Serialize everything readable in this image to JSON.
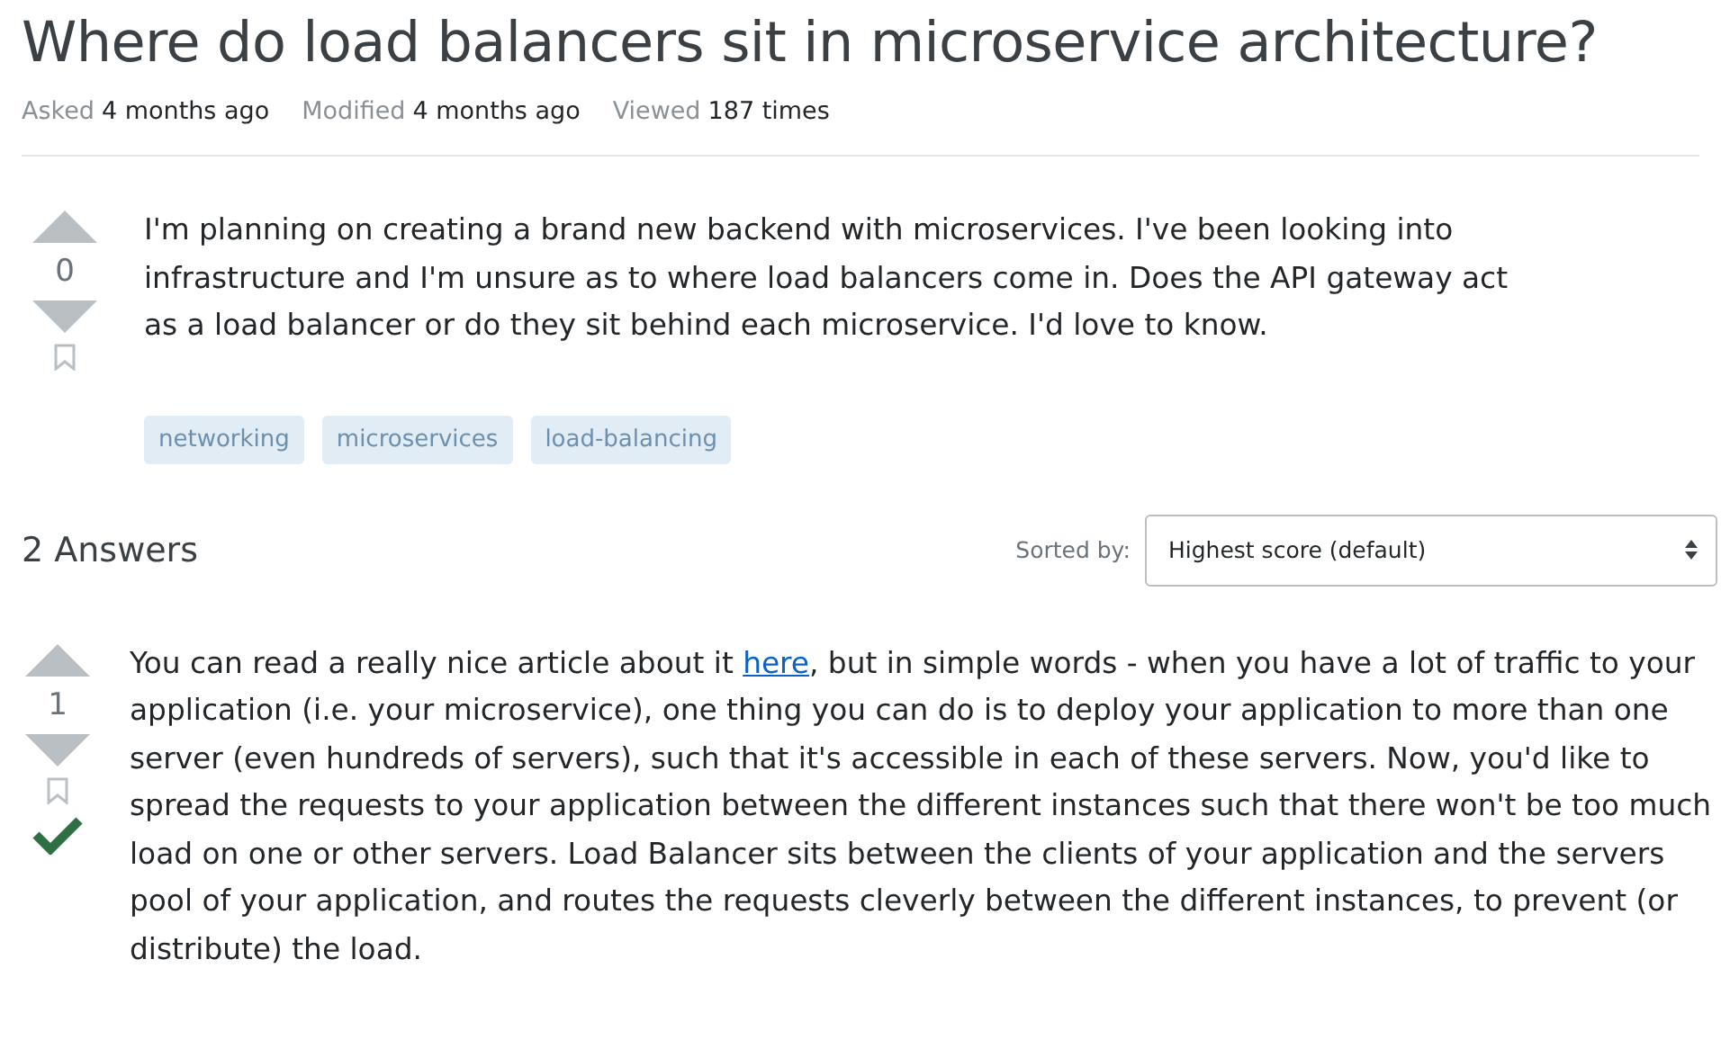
{
  "title": "Where do load balancers sit in microservice architecture?",
  "meta": [
    {
      "label": "Asked",
      "value": "4 months ago"
    },
    {
      "label": "Modified",
      "value": "4 months ago"
    },
    {
      "label": "Viewed",
      "value": "187 times"
    }
  ],
  "question": {
    "score": "0",
    "accepted": false,
    "body": [
      {
        "kind": "text",
        "text": "I'm planning on creating a brand new backend with microservices. I've been looking into infrastructure and I'm unsure as to where load balancers come in. Does the API gateway act as a load balancer or do they sit behind each microservice. I'd love to know."
      }
    ],
    "tags": [
      "networking",
      "microservices",
      "load-balancing"
    ]
  },
  "answers_header": {
    "count": "2 Answers",
    "sort_label": "Sorted by:",
    "sort_value": "Highest score (default)"
  },
  "answers": [
    {
      "score": "1",
      "accepted": true,
      "body": [
        {
          "kind": "text",
          "text": "You can read a really nice article about it "
        },
        {
          "kind": "link",
          "text": "here"
        },
        {
          "kind": "text",
          "text": ", but in simple words - when you have a lot of traffic to your application (i.e. your microservice), one thing you can do is to deploy your application to more than one server (even hundreds of servers), such that it's accessible in each of these servers. Now, you'd like to spread the requests to your application between the different instances such that there won't be too much load on one or other servers. Load Balancer sits between the clients of your application and the servers pool of your application, and routes the requests cleverly between the different instances, to prevent (or distribute) the load."
        }
      ]
    }
  ]
}
